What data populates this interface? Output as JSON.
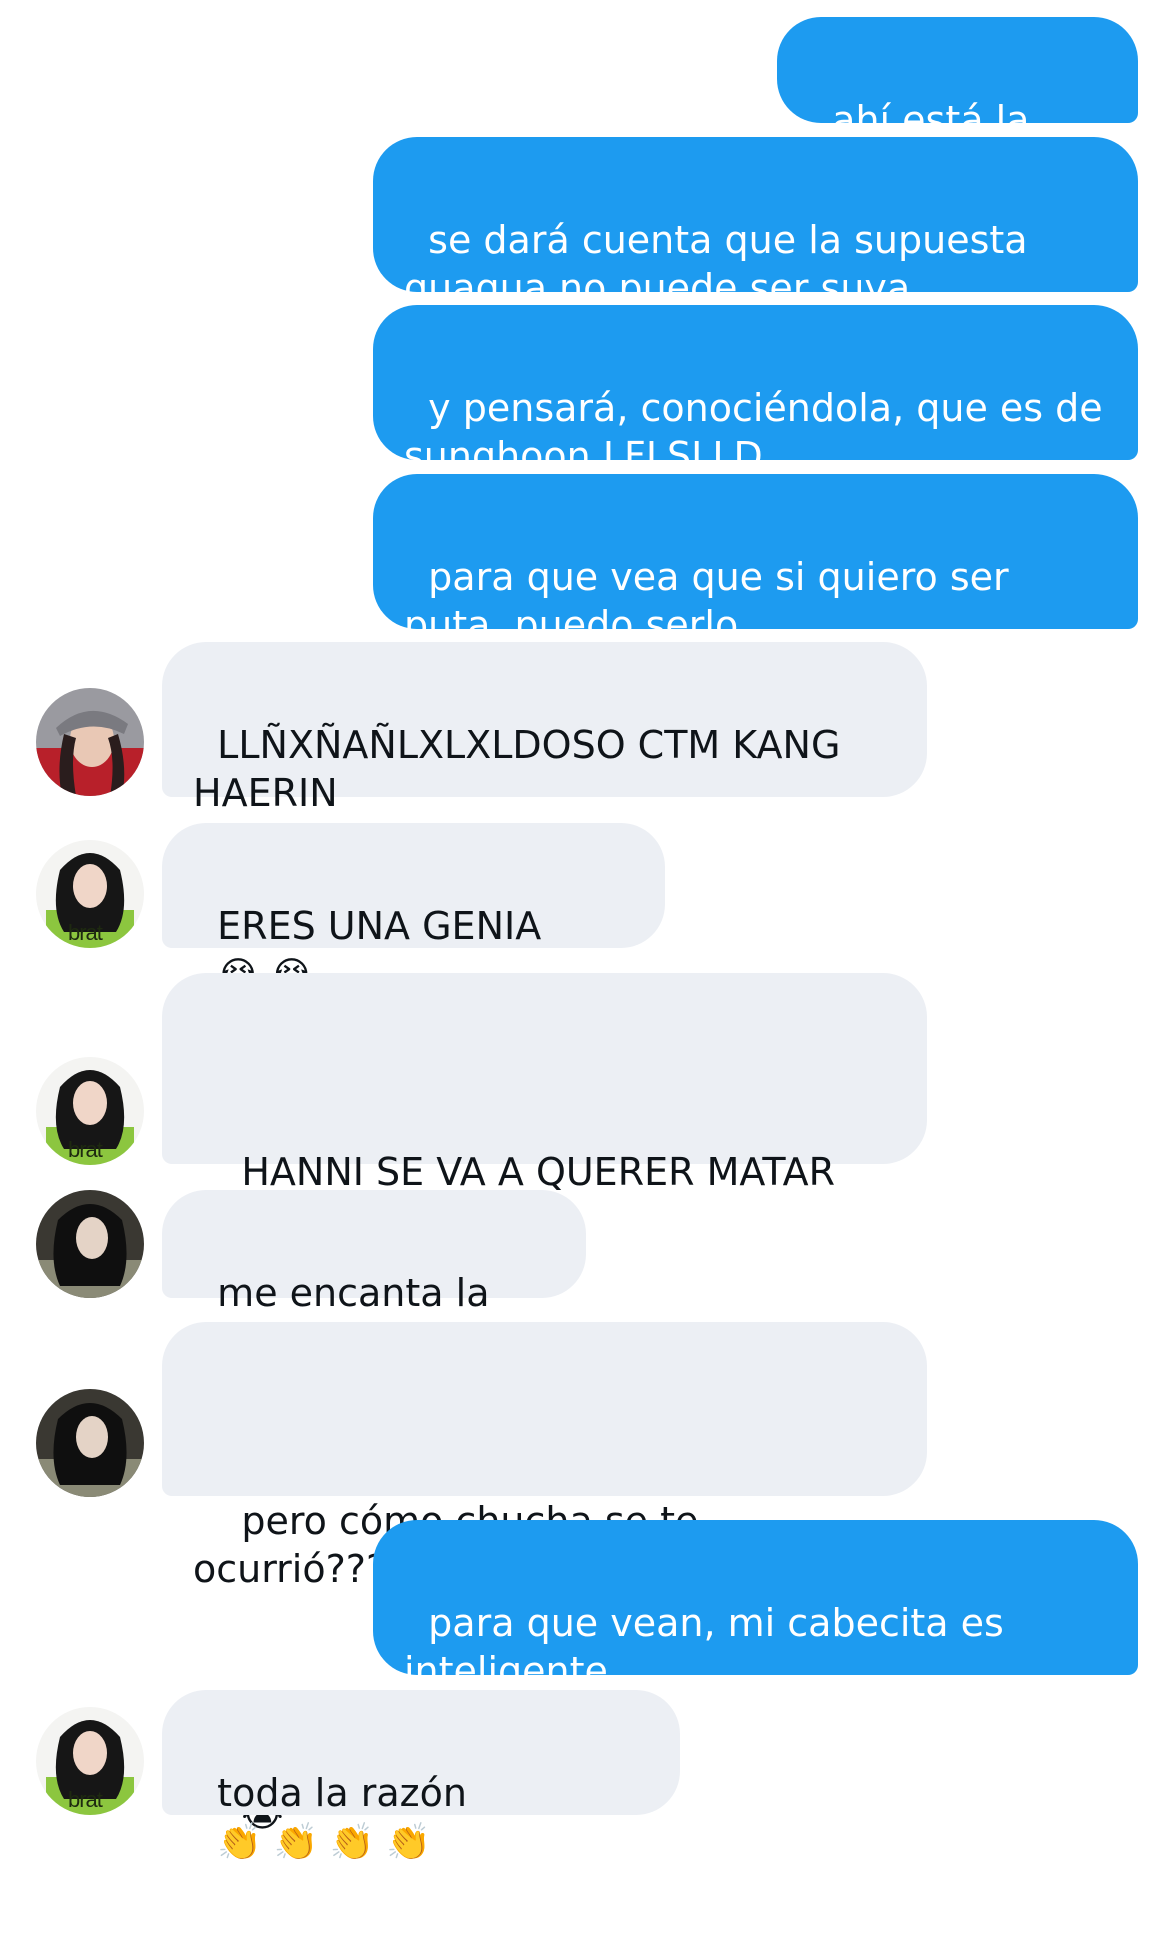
{
  "colors": {
    "sent_bubble": "#1d9bf0",
    "received_bubble": "#eceff4",
    "sent_text": "#ffffff",
    "received_text": "#0f1419",
    "avatar_green": "#8cc63f"
  },
  "messages": [
    {
      "direction": "sent",
      "text": "ahí está la cosa"
    },
    {
      "direction": "sent",
      "text": "se dará cuenta que la supuesta guagua no puede ser suya"
    },
    {
      "direction": "sent",
      "text": "y pensará, conociéndola, que es de sunghoon LFLSLLD"
    },
    {
      "direction": "sent",
      "text": "para que vea que si quiero ser puta, puedo serlo"
    },
    {
      "direction": "received",
      "avatar": "avatar-cap-girl",
      "text": "LLÑXÑAÑLXLXLDOSO CTM KANG HAERIN"
    },
    {
      "direction": "received",
      "avatar": "avatar-brat-girl",
      "text": "ERES UNA GENIA",
      "emoji": "😭 😭"
    },
    {
      "direction": "received",
      "avatar": "avatar-brat-girl",
      "text": "HANNI SE VA A QUERER MATAR",
      "emoji": "😭",
      "emoji_line2": "😭 😭 😭"
    },
    {
      "direction": "received",
      "avatar": "avatar-dark-girl",
      "text": "me encanta la idea"
    },
    {
      "direction": "received",
      "avatar": "avatar-dark-girl",
      "text": "pero cómo chucha se te ocurrió????",
      "emoji_line2": "😭"
    },
    {
      "direction": "sent",
      "text": "para que vean, mi cabecita es inteligente"
    },
    {
      "direction": "received",
      "avatar": "avatar-brat-girl",
      "text": "toda la razón",
      "emoji": "👏 👏 👏 👏"
    }
  ],
  "avatars": {
    "brat_label": "brat"
  }
}
